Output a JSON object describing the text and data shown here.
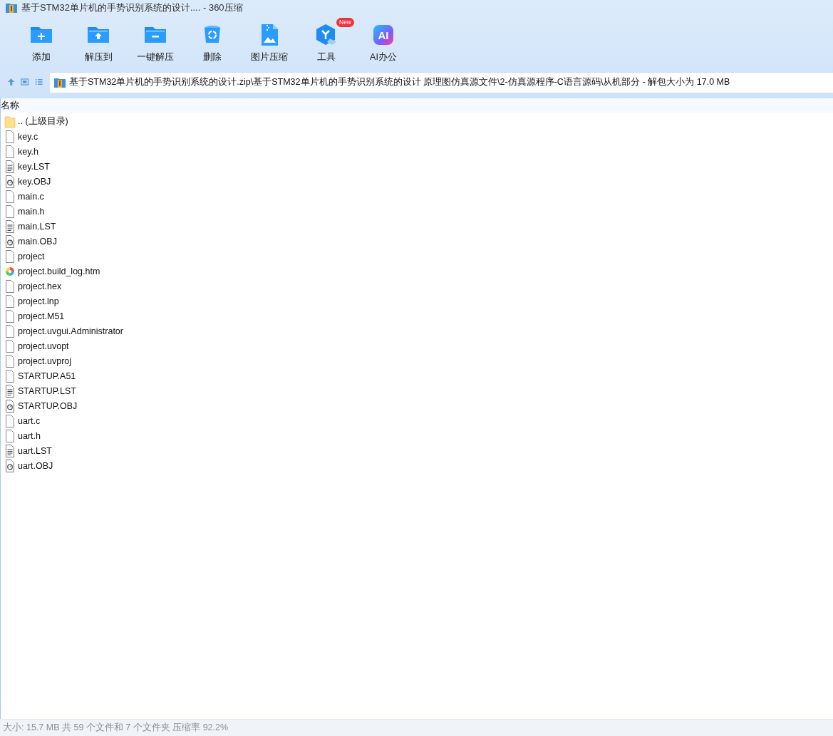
{
  "window": {
    "title": "基于STM32单片机的手势识别系统的设计.... - 360压缩"
  },
  "toolbar": [
    {
      "label": "添加",
      "kind": "add"
    },
    {
      "label": "解压到",
      "kind": "extract"
    },
    {
      "label": "一键解压",
      "kind": "oneclick"
    },
    {
      "label": "删除",
      "kind": "delete"
    },
    {
      "label": "图片压缩",
      "kind": "image"
    },
    {
      "label": "工具",
      "kind": "tools",
      "badge": "New"
    },
    {
      "label": "AI办公",
      "kind": "ai",
      "icon_text": "AI"
    }
  ],
  "address": {
    "path": "基于STM32单片机的手势识别系统的设计.zip\\基于STM32单片机的手势识别系统的设计 原理图仿真源文件\\2-仿真源程序-C语言源码\\从机部分 - 解包大小为 17.0 MB"
  },
  "table": {
    "columns": [
      "名称"
    ],
    "rows": [
      {
        "name": ".. (上级目录)",
        "kind": "folder"
      },
      {
        "name": "key.c",
        "kind": "blank"
      },
      {
        "name": "key.h",
        "kind": "blank"
      },
      {
        "name": "key.LST",
        "kind": "text"
      },
      {
        "name": "key.OBJ",
        "kind": "obj"
      },
      {
        "name": "main.c",
        "kind": "blank"
      },
      {
        "name": "main.h",
        "kind": "blank"
      },
      {
        "name": "main.LST",
        "kind": "text"
      },
      {
        "name": "main.OBJ",
        "kind": "obj"
      },
      {
        "name": "project",
        "kind": "blank"
      },
      {
        "name": "project.build_log.htm",
        "kind": "htm"
      },
      {
        "name": "project.hex",
        "kind": "blank"
      },
      {
        "name": "project.lnp",
        "kind": "blank"
      },
      {
        "name": "project.M51",
        "kind": "blank"
      },
      {
        "name": "project.uvgui.Administrator",
        "kind": "blank"
      },
      {
        "name": "project.uvopt",
        "kind": "blank"
      },
      {
        "name": "project.uvproj",
        "kind": "blank"
      },
      {
        "name": "STARTUP.A51",
        "kind": "blank"
      },
      {
        "name": "STARTUP.LST",
        "kind": "text"
      },
      {
        "name": "STARTUP.OBJ",
        "kind": "obj"
      },
      {
        "name": "uart.c",
        "kind": "blank"
      },
      {
        "name": "uart.h",
        "kind": "blank"
      },
      {
        "name": "uart.LST",
        "kind": "text"
      },
      {
        "name": "uart.OBJ",
        "kind": "obj"
      }
    ]
  },
  "status_bar": "大小: 15.7 MB 共 59 个文件和 7 个文件夹 压缩率 92.2%"
}
